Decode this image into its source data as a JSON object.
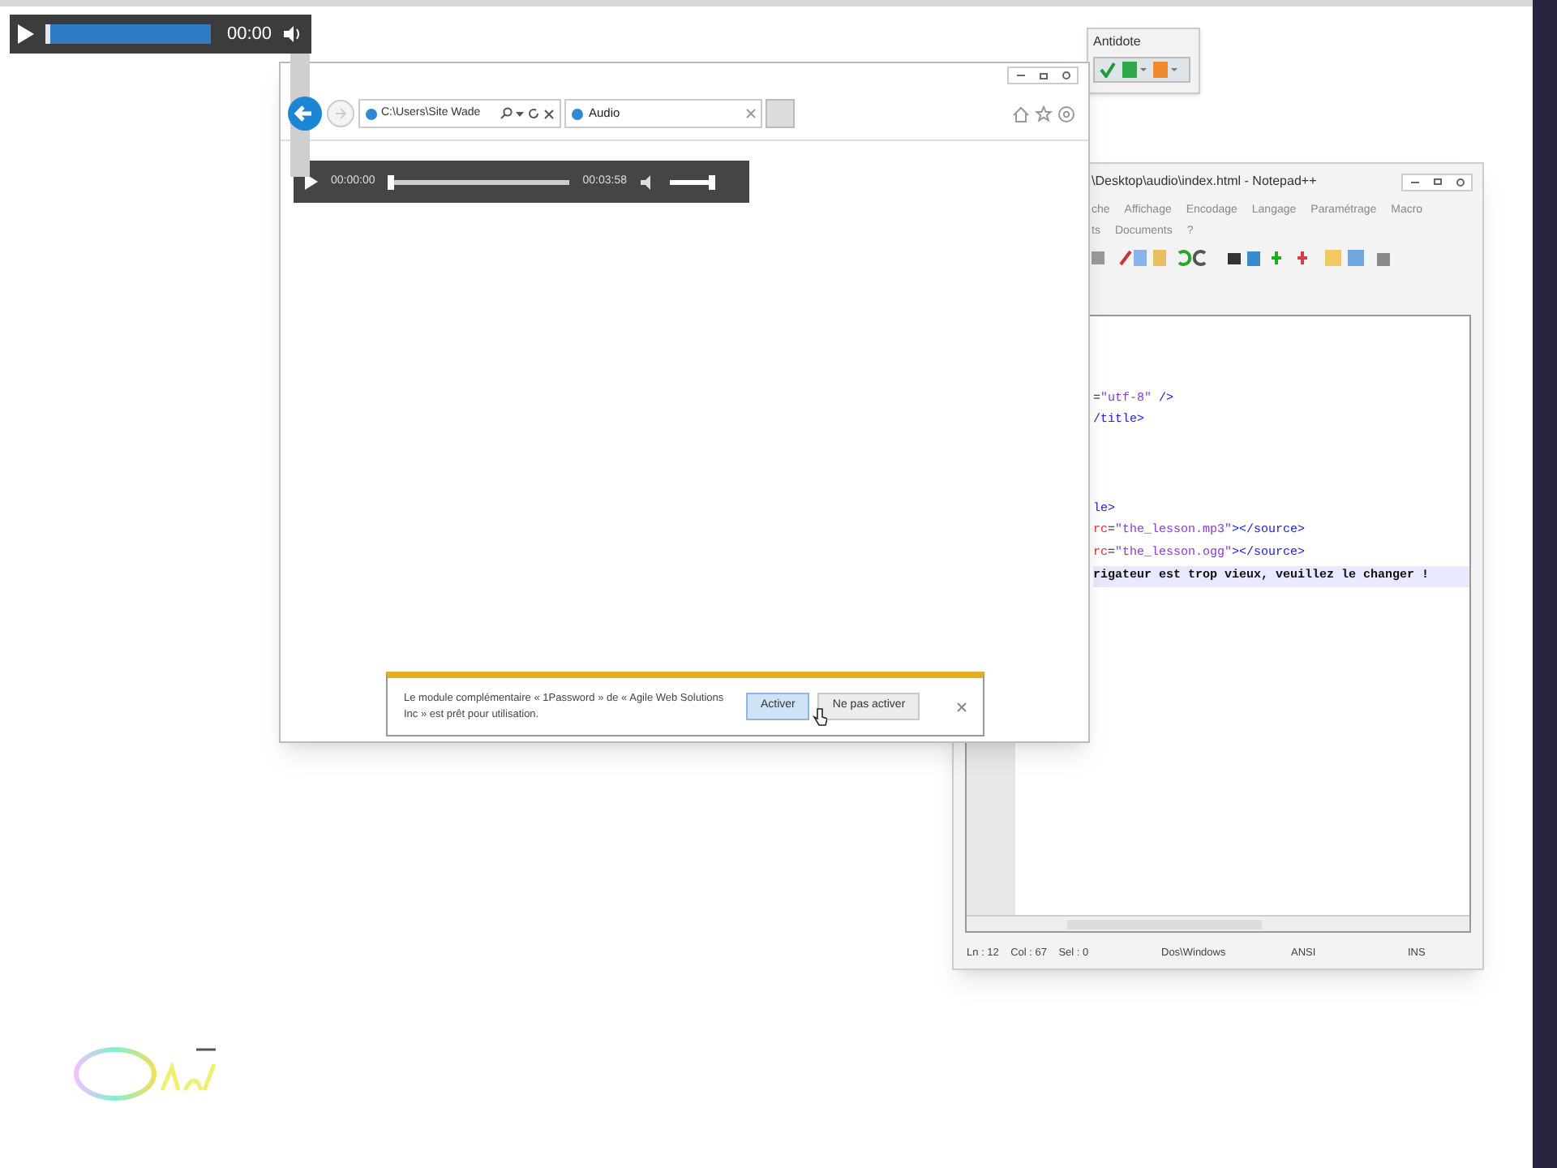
{
  "mini_player": {
    "time": "00:00",
    "level": 0
  },
  "browser": {
    "address": "C:\\Users\\Site Wade",
    "tabs": [
      {
        "label": "Audio",
        "selected": true
      }
    ],
    "audio_player": {
      "current": "00:00:00",
      "duration": "00:03:58",
      "level": 0,
      "volume": {
        "level": 1
      }
    },
    "notification": {
      "message": "Le module complémentaire « 1Password » de « Agile Web Solutions Inc » est prêt pour utilisation.",
      "buttons": [
        {
          "label": "Activer",
          "hovered": true
        },
        {
          "label": "Ne pas activer",
          "hovered": false
        }
      ]
    }
  },
  "antidote": {
    "title": "Antidote"
  },
  "notepad": {
    "title": "\\Desktop\\audio\\index.html - Notepad++",
    "menu": [
      "che",
      "Affichage",
      "Encodage",
      "Langage",
      "Paramétrage",
      "Macro"
    ],
    "menu_row_2": [
      "ts",
      "Documents",
      "?"
    ],
    "lines": [
      {
        "kind": "blank",
        "highlighted": false
      },
      {
        "kind": "blank",
        "highlighted": false
      },
      {
        "kind": "blank",
        "highlighted": false
      },
      {
        "kind": "code",
        "highlighted": false,
        "parts": [
          {
            "kind": "plain",
            "text": "="
          },
          {
            "kind": "string",
            "text": "\"utf-8\""
          },
          {
            "kind": "tag",
            "text": " />"
          }
        ]
      },
      {
        "kind": "code",
        "highlighted": false,
        "parts": [
          {
            "kind": "tag",
            "text": "/title>"
          }
        ]
      },
      {
        "kind": "blank",
        "highlighted": false
      },
      {
        "kind": "blank",
        "highlighted": false
      },
      {
        "kind": "blank",
        "highlighted": false
      },
      {
        "kind": "code",
        "highlighted": false,
        "parts": [
          {
            "kind": "tag",
            "text": "le>"
          }
        ]
      },
      {
        "kind": "code",
        "highlighted": false,
        "parts": [
          {
            "kind": "attr",
            "text": "rc"
          },
          {
            "kind": "plain",
            "text": "="
          },
          {
            "kind": "string",
            "text": "\"the_lesson.mp3\""
          },
          {
            "kind": "tag",
            "text": "></source>"
          }
        ]
      },
      {
        "kind": "code",
        "highlighted": false,
        "parts": [
          {
            "kind": "attr",
            "text": "rc"
          },
          {
            "kind": "plain",
            "text": "="
          },
          {
            "kind": "string",
            "text": "\"the_lesson.ogg\""
          },
          {
            "kind": "tag",
            "text": "></source>"
          }
        ]
      },
      {
        "kind": "code",
        "highlighted": true,
        "parts": [
          {
            "kind": "plain",
            "text": "rigateur est trop vieux, veuillez le changer !"
          }
        ]
      }
    ],
    "status": [
      "Ln : 12    Col : 67    Sel : 0",
      "Dos\\Windows",
      "ANSI",
      "INS"
    ]
  }
}
